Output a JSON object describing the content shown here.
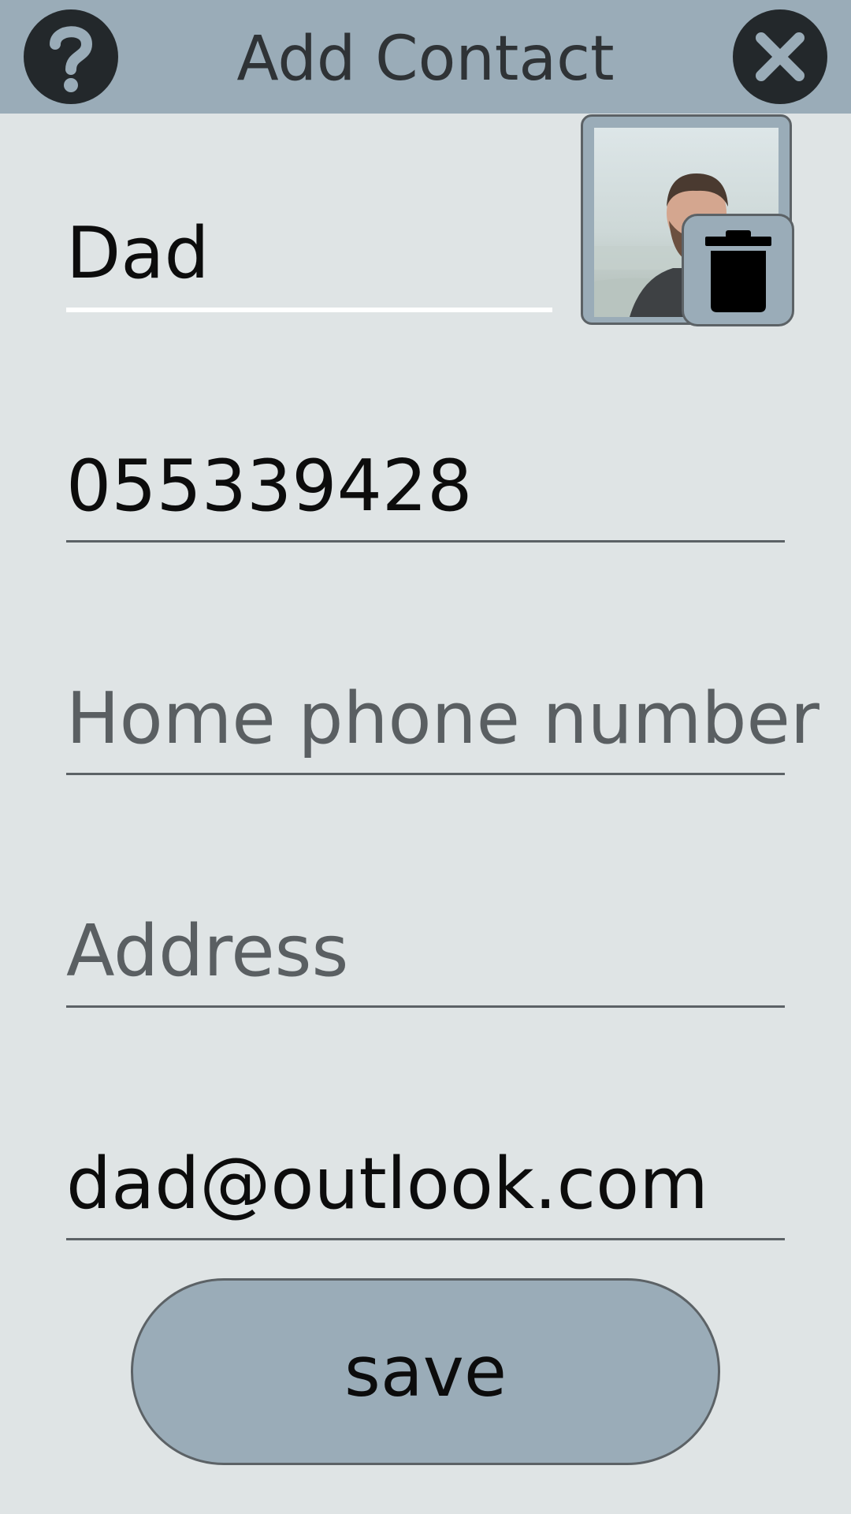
{
  "header": {
    "title": "Add Contact",
    "help_icon": "question-mark-icon",
    "close_icon": "close-icon"
  },
  "form": {
    "name": {
      "value": "Dad",
      "placeholder": ""
    },
    "mobile_phone": {
      "value": "055339428",
      "placeholder": ""
    },
    "home_phone": {
      "value": "",
      "placeholder": "Home phone number"
    },
    "address": {
      "value": "",
      "placeholder": "Address"
    },
    "email": {
      "value": "dad@outlook.com",
      "placeholder": ""
    }
  },
  "photo": {
    "delete_icon": "trash-icon"
  },
  "actions": {
    "save_label": "save"
  },
  "colors": {
    "background": "#dfe4e5",
    "header": "#9aacb8",
    "icon_button": "#23282b",
    "text": "#0c0c0c",
    "placeholder": "#5a5f62",
    "divider": "#5c6266",
    "active_underline": "#ffffff"
  }
}
